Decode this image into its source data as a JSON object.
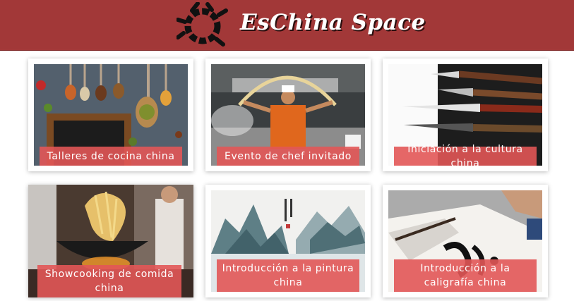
{
  "header": {
    "site_title": "EsChina Space",
    "background_color": "#a23838",
    "logo_icon": "ensō-brush-circle-icon"
  },
  "cards": [
    {
      "label": "Talleres de cocina china",
      "image": "spices-on-spoons-photo"
    },
    {
      "label": "Evento de chef invitado",
      "image": "chef-pulling-noodles-photo"
    },
    {
      "label": "Iniciación a la cultura china",
      "image": "calligraphy-brushes-photo"
    },
    {
      "label": "Showcooking de comida china",
      "image": "wok-noodles-photo"
    },
    {
      "label": "Introducción a la pintura china",
      "image": "ink-landscape-painting-photo"
    },
    {
      "label": "Introducción a la caligrafía china",
      "image": "calligraphy-writing-photo"
    }
  ],
  "colors": {
    "caption_overlay": "#e25656",
    "card_background": "#ffffff"
  }
}
